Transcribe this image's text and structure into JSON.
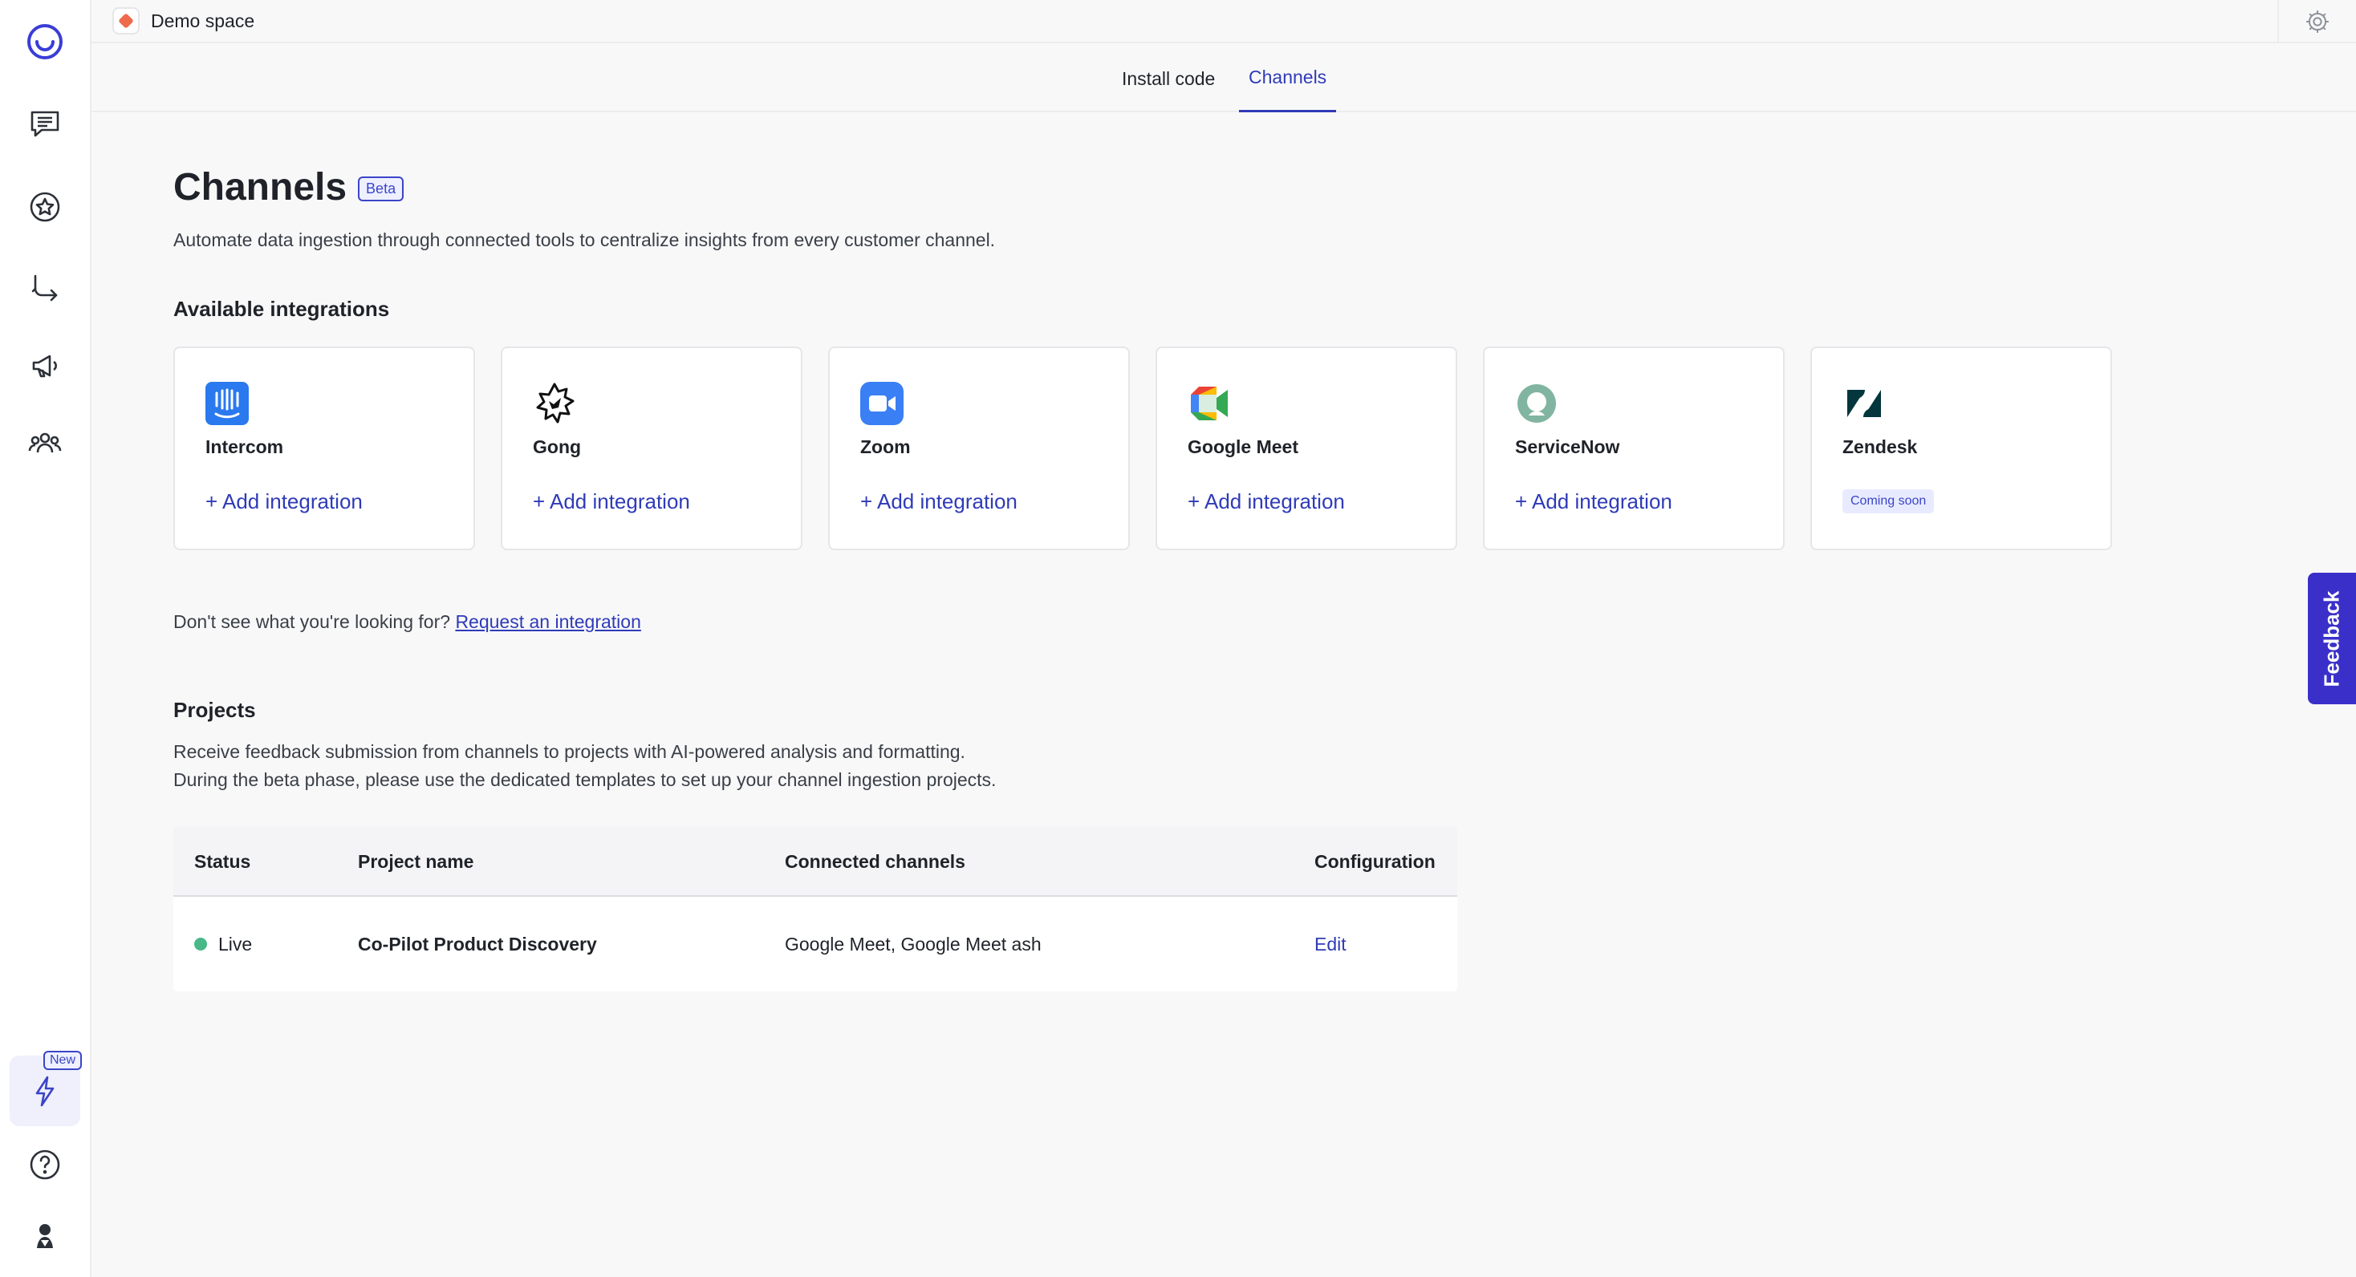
{
  "topbar": {
    "space_name": "Demo space"
  },
  "tabs": [
    {
      "label": "Install code"
    },
    {
      "label": "Channels"
    }
  ],
  "rail": {
    "new_badge": "New"
  },
  "page": {
    "title": "Channels",
    "badge": "Beta",
    "subtitle": "Automate data ingestion through connected tools to centralize insights from every customer channel."
  },
  "integrations": {
    "heading": "Available integrations",
    "items": [
      {
        "name": "Intercom",
        "action": "+ Add integration",
        "icon": "intercom-icon"
      },
      {
        "name": "Gong",
        "action": "+ Add integration",
        "icon": "gong-icon"
      },
      {
        "name": "Zoom",
        "action": "+ Add integration",
        "icon": "zoom-icon"
      },
      {
        "name": "Google Meet",
        "action": "+ Add integration",
        "icon": "google-meet-icon"
      },
      {
        "name": "ServiceNow",
        "action": "+ Add integration",
        "icon": "servicenow-icon"
      },
      {
        "name": "Zendesk",
        "status": "Coming soon",
        "icon": "zendesk-icon"
      }
    ],
    "request_prefix": "Don't see what you're looking for?",
    "request_link": "Request an integration"
  },
  "projects": {
    "heading": "Projects",
    "desc_line1": "Receive feedback submission from channels to projects with AI-powered analysis and formatting.",
    "desc_line2": "During the beta phase, please use the dedicated templates to set up your channel ingestion projects.",
    "columns": [
      "Status",
      "Project name",
      "Connected channels",
      "Configuration"
    ],
    "rows": [
      {
        "status": "Live",
        "name": "Co-Pilot Product Discovery",
        "channels": "Google Meet, Google Meet ash",
        "config": "Edit"
      }
    ]
  },
  "feedback_tab": "Feedback",
  "colors": {
    "accent": "#2f3bb8",
    "live": "#48b888",
    "feedback": "#3a30c9"
  }
}
